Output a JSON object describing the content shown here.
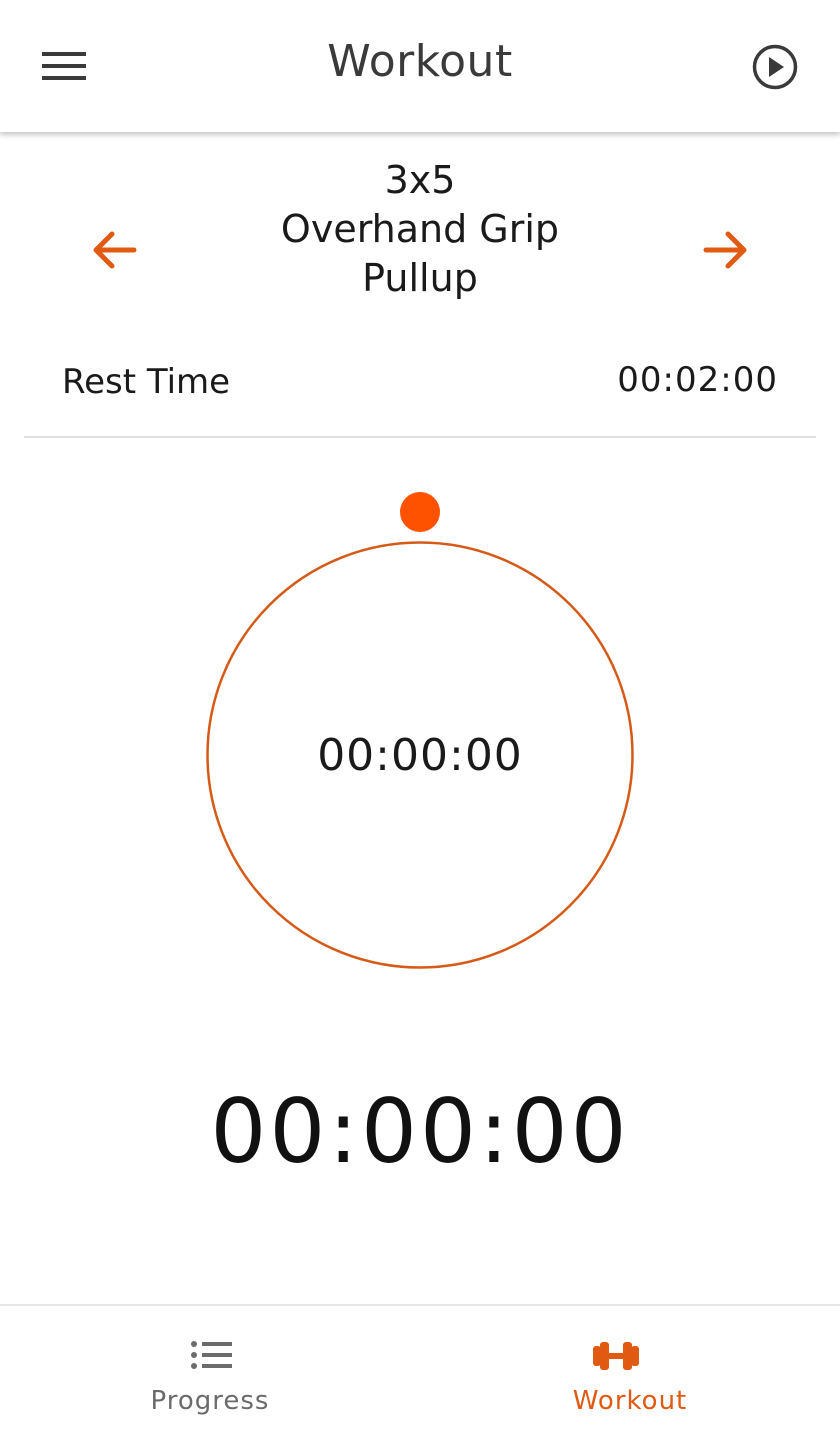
{
  "header": {
    "title": "Workout",
    "menu_icon": "hamburger-menu-icon",
    "play_icon": "play-circle-icon"
  },
  "exercise": {
    "sets_reps": "3x5",
    "name_line1": "Overhand Grip",
    "name_line2": "Pullup",
    "prev_icon": "arrow-left-icon",
    "next_icon": "arrow-right-icon"
  },
  "rest": {
    "label": "Rest Time",
    "value": "00:02:00"
  },
  "timer": {
    "ring_time": "00:00:00",
    "big_time": "00:00:00",
    "progress": 0
  },
  "bottom_nav": {
    "items": [
      {
        "label": "Progress",
        "icon": "list-icon",
        "active": false
      },
      {
        "label": "Workout",
        "icon": "dumbbell-icon",
        "active": true
      }
    ]
  },
  "colors": {
    "accent": "#e05a12",
    "dot": "#fe5200",
    "ring": "#d65a17",
    "text": "#1a1a1a",
    "muted": "#6b6b6b"
  }
}
